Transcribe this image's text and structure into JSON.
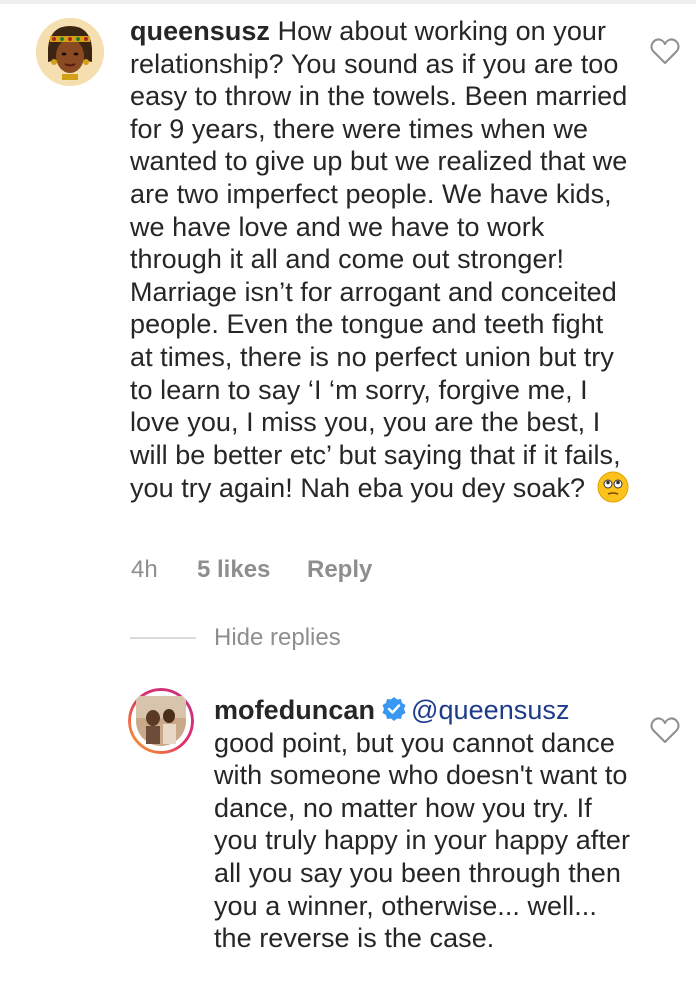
{
  "comments": [
    {
      "username": "queensusz",
      "text": "How about working on your relationship? You sound as if you are too easy to throw in the towels. Been married for 9 years, there were times when we wanted to give up but we realized that we are two imperfect people. We have kids, we have love and we have to work through it all and come out stronger! Marriage isn’t for arrogant and conceited people. Even the tongue and teeth fight at times, there is no perfect union but try to learn to say ‘I ‘m sorry, forgive me, I love you, I miss you, you are the best, I will be better etc’ but saying that if it fails, you try again! Nah eba you dey soak?",
      "emoji_icon": "flushed-face-emoji",
      "time": "4h",
      "likes": "5 likes",
      "reply_label": "Reply",
      "avatar_icon": "illustrated-woman-avatar"
    }
  ],
  "hide_replies_label": "Hide replies",
  "replies": [
    {
      "username": "mofeduncan",
      "verified": true,
      "mention": "@queensusz",
      "text": "good point, but you cannot dance with someone who doesn't want to dance, no matter how you try. If you truly happy in your happy after all you say you been through then you a winner, otherwise... well... the reverse is the case.",
      "avatar_icon": "photo-avatar-with-story-ring"
    }
  ],
  "colors": {
    "text": "#262626",
    "meta": "#8e8e8e",
    "verified": "#3897f0",
    "story_ring": "#e1306c"
  }
}
